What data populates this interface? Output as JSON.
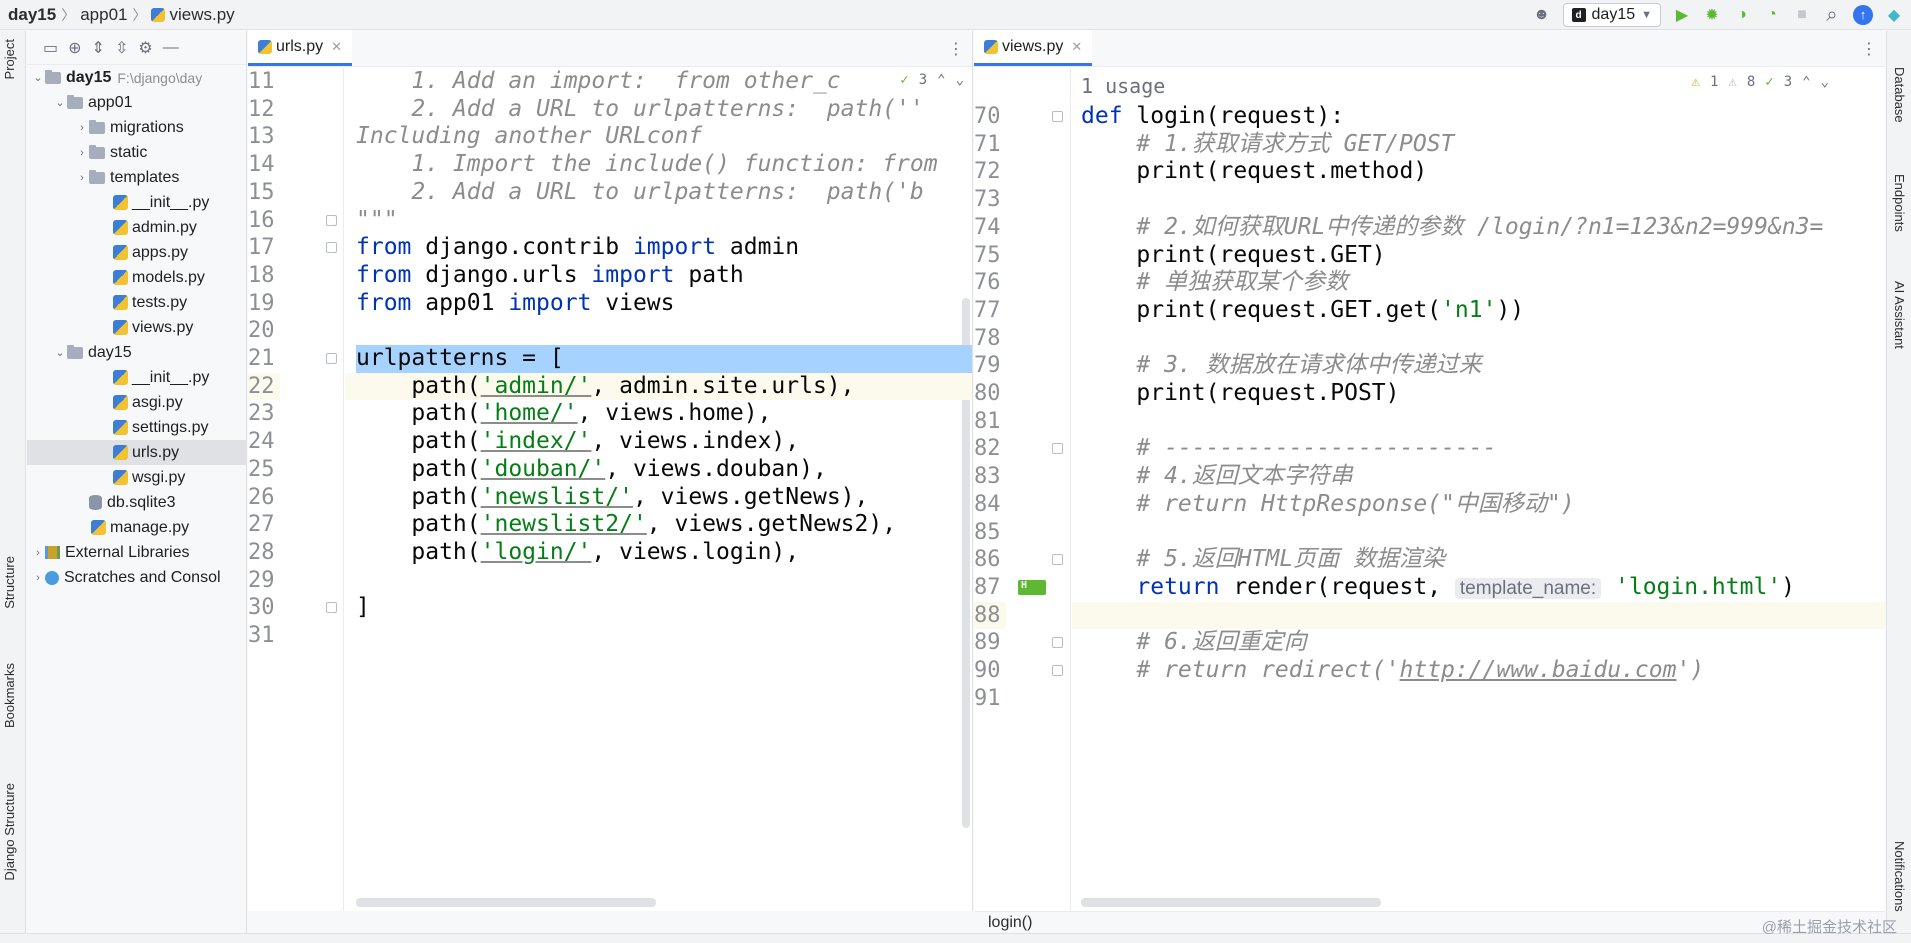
{
  "breadcrumb": {
    "project": "day15",
    "folder": "app01",
    "file": "views.py"
  },
  "run_config": {
    "label": "day15"
  },
  "project_panel": {
    "project_root_name": "day15",
    "project_root_path": "F:\\django\\day",
    "items": [
      {
        "label": "app01",
        "type": "folder",
        "depth": 1,
        "expanded": true
      },
      {
        "label": "migrations",
        "type": "folder",
        "depth": 2,
        "expanded": false
      },
      {
        "label": "static",
        "type": "folder",
        "depth": 2,
        "expanded": false
      },
      {
        "label": "templates",
        "type": "folder",
        "depth": 2,
        "expanded": false
      },
      {
        "label": "__init__.py",
        "type": "py",
        "depth": 3
      },
      {
        "label": "admin.py",
        "type": "py",
        "depth": 3
      },
      {
        "label": "apps.py",
        "type": "py",
        "depth": 3
      },
      {
        "label": "models.py",
        "type": "py",
        "depth": 3
      },
      {
        "label": "tests.py",
        "type": "py",
        "depth": 3
      },
      {
        "label": "views.py",
        "type": "py",
        "depth": 3
      },
      {
        "label": "day15",
        "type": "folder",
        "depth": 1,
        "expanded": true
      },
      {
        "label": "__init__.py",
        "type": "py",
        "depth": 3
      },
      {
        "label": "asgi.py",
        "type": "py",
        "depth": 3
      },
      {
        "label": "settings.py",
        "type": "py",
        "depth": 3
      },
      {
        "label": "urls.py",
        "type": "py",
        "depth": 3,
        "selected": true
      },
      {
        "label": "wsgi.py",
        "type": "py",
        "depth": 3
      },
      {
        "label": "db.sqlite3",
        "type": "db",
        "depth": 2
      },
      {
        "label": "manage.py",
        "type": "py",
        "depth": 2
      },
      {
        "label": "External Libraries",
        "type": "lib",
        "depth": 0,
        "expanded": false
      },
      {
        "label": "Scratches and Consol",
        "type": "scratch",
        "depth": 0,
        "expanded": false
      }
    ]
  },
  "left_tool_strip": {
    "project": "Project",
    "structure": "Structure",
    "bookmarks": "Bookmarks",
    "django_structure": "Django Structure"
  },
  "right_tool_strip": {
    "database": "Database",
    "endpoints": "Endpoints",
    "ai_assistant": "AI Assistant",
    "notifications": "Notifications"
  },
  "editor_left": {
    "tab": "urls.py",
    "inspection": {
      "weak_warnings": "3"
    },
    "lines": [
      {
        "n": "11",
        "tokens": [
          {
            "t": "    1. Add an import:  from other_c",
            "c": "cm"
          }
        ]
      },
      {
        "n": "12",
        "tokens": [
          {
            "t": "    2. Add a URL to urlpatterns:  path(''",
            "c": "cm"
          }
        ]
      },
      {
        "n": "13",
        "tokens": [
          {
            "t": "Including another URLconf",
            "c": "cm"
          }
        ]
      },
      {
        "n": "14",
        "tokens": [
          {
            "t": "    1. Import the include() function: from",
            "c": "cm"
          }
        ]
      },
      {
        "n": "15",
        "tokens": [
          {
            "t": "    2. Add a URL to urlpatterns:  path('b",
            "c": "cm"
          }
        ]
      },
      {
        "n": "16",
        "tokens": [
          {
            "t": "\"\"\"",
            "c": "cm"
          }
        ]
      },
      {
        "n": "17",
        "tokens": [
          {
            "t": "from",
            "c": "kw"
          },
          {
            "t": " django.contrib ",
            "c": ""
          },
          {
            "t": "import",
            "c": "kw"
          },
          {
            "t": " admin",
            "c": ""
          }
        ]
      },
      {
        "n": "18",
        "tokens": [
          {
            "t": "from",
            "c": "kw"
          },
          {
            "t": " django.urls ",
            "c": ""
          },
          {
            "t": "import",
            "c": "kw"
          },
          {
            "t": " path",
            "c": ""
          }
        ]
      },
      {
        "n": "19",
        "tokens": [
          {
            "t": "from",
            "c": "kw"
          },
          {
            "t": " app01 ",
            "c": ""
          },
          {
            "t": "import",
            "c": "kw"
          },
          {
            "t": " views",
            "c": ""
          }
        ]
      },
      {
        "n": "20",
        "tokens": []
      },
      {
        "n": "21",
        "tokens": [
          {
            "t": "urlpatterns = [",
            "c": ""
          }
        ],
        "sel": true
      },
      {
        "n": "22",
        "tokens": [
          {
            "t": "    path(",
            "c": ""
          },
          {
            "t": "'admin/'",
            "c": "st ul"
          },
          {
            "t": ", admin.site.urls),",
            "c": ""
          }
        ],
        "cur": true
      },
      {
        "n": "23",
        "tokens": [
          {
            "t": "    path(",
            "c": ""
          },
          {
            "t": "'home/'",
            "c": "st ul"
          },
          {
            "t": ", views.home),",
            "c": ""
          }
        ]
      },
      {
        "n": "24",
        "tokens": [
          {
            "t": "    path(",
            "c": ""
          },
          {
            "t": "'index/'",
            "c": "st ul"
          },
          {
            "t": ", views.index),",
            "c": ""
          }
        ]
      },
      {
        "n": "25",
        "tokens": [
          {
            "t": "    path(",
            "c": ""
          },
          {
            "t": "'douban/'",
            "c": "st ul"
          },
          {
            "t": ", views.douban),",
            "c": ""
          }
        ]
      },
      {
        "n": "26",
        "tokens": [
          {
            "t": "    path(",
            "c": ""
          },
          {
            "t": "'newslist/'",
            "c": "st ul"
          },
          {
            "t": ", views.getNews),",
            "c": ""
          }
        ]
      },
      {
        "n": "27",
        "tokens": [
          {
            "t": "    path(",
            "c": ""
          },
          {
            "t": "'newslist2/'",
            "c": "st ul"
          },
          {
            "t": ", views.getNews2),",
            "c": ""
          }
        ]
      },
      {
        "n": "28",
        "tokens": [
          {
            "t": "    path(",
            "c": ""
          },
          {
            "t": "'login/'",
            "c": "st ul"
          },
          {
            "t": ", views.login),",
            "c": ""
          }
        ]
      },
      {
        "n": "29",
        "tokens": []
      },
      {
        "n": "30",
        "tokens": [
          {
            "t": "]",
            "c": ""
          }
        ]
      },
      {
        "n": "31",
        "tokens": []
      }
    ]
  },
  "editor_right": {
    "tab": "views.py",
    "usage_hint": "1 usage",
    "inspection": {
      "warnings": "1",
      "weak_warnings": "8",
      "typos": "3"
    },
    "lines": [
      {
        "n": "70",
        "tokens": [
          {
            "t": "def",
            "c": "kw"
          },
          {
            "t": " login(request):",
            "c": ""
          }
        ]
      },
      {
        "n": "71",
        "tokens": [
          {
            "t": "    ",
            "c": ""
          },
          {
            "t": "# 1.获取请求方式 GET/POST",
            "c": "cm"
          }
        ]
      },
      {
        "n": "72",
        "tokens": [
          {
            "t": "    print(request.method)",
            "c": ""
          }
        ]
      },
      {
        "n": "73",
        "tokens": []
      },
      {
        "n": "74",
        "tokens": [
          {
            "t": "    ",
            "c": ""
          },
          {
            "t": "# 2.如何获取URL中传递的参数 /login/?n1=123&n2=999&n3=",
            "c": "cm"
          }
        ]
      },
      {
        "n": "75",
        "tokens": [
          {
            "t": "    print(request.GET)",
            "c": ""
          }
        ]
      },
      {
        "n": "76",
        "tokens": [
          {
            "t": "    ",
            "c": ""
          },
          {
            "t": "# 单独获取某个参数",
            "c": "cm"
          }
        ]
      },
      {
        "n": "77",
        "tokens": [
          {
            "t": "    print(request.GET.get(",
            "c": ""
          },
          {
            "t": "'n1'",
            "c": "st"
          },
          {
            "t": "))",
            "c": ""
          }
        ]
      },
      {
        "n": "78",
        "tokens": []
      },
      {
        "n": "79",
        "tokens": [
          {
            "t": "    ",
            "c": ""
          },
          {
            "t": "# 3. 数据放在请求体中传递过来",
            "c": "cm"
          }
        ]
      },
      {
        "n": "80",
        "tokens": [
          {
            "t": "    print(request.POST)",
            "c": ""
          }
        ]
      },
      {
        "n": "81",
        "tokens": []
      },
      {
        "n": "82",
        "tokens": [
          {
            "t": "    ",
            "c": ""
          },
          {
            "t": "# ------------------------",
            "c": "cm"
          }
        ]
      },
      {
        "n": "83",
        "tokens": [
          {
            "t": "    ",
            "c": ""
          },
          {
            "t": "# 4.返回文本字符串",
            "c": "cm"
          }
        ]
      },
      {
        "n": "84",
        "tokens": [
          {
            "t": "    ",
            "c": ""
          },
          {
            "t": "# return HttpResponse(\"中国移动\")",
            "c": "cm"
          }
        ]
      },
      {
        "n": "85",
        "tokens": []
      },
      {
        "n": "86",
        "tokens": [
          {
            "t": "    ",
            "c": ""
          },
          {
            "t": "# 5.返回HTML页面 数据渲染",
            "c": "cm"
          }
        ]
      },
      {
        "n": "87",
        "tokens": [
          {
            "t": "    ",
            "c": ""
          },
          {
            "t": "return",
            "c": "kw"
          },
          {
            "t": " render(request, ",
            "c": ""
          },
          {
            "t": "template_name:",
            "c": "hint"
          },
          {
            "t": " ",
            "c": ""
          },
          {
            "t": "'login.html'",
            "c": "st"
          },
          {
            "t": ")",
            "c": ""
          }
        ]
      },
      {
        "n": "88",
        "tokens": [],
        "cur": true
      },
      {
        "n": "89",
        "tokens": [
          {
            "t": "    ",
            "c": ""
          },
          {
            "t": "# 6.返回重定向",
            "c": "cm"
          }
        ]
      },
      {
        "n": "90",
        "tokens": [
          {
            "t": "    ",
            "c": ""
          },
          {
            "t": "# return redirect('",
            "c": "cm"
          },
          {
            "t": "http://www.baidu.com",
            "c": "cm ul"
          },
          {
            "t": "')",
            "c": "cm"
          }
        ]
      },
      {
        "n": "91",
        "tokens": []
      }
    ]
  },
  "status_bar": {
    "breadcrumb": "login()"
  },
  "watermark": "@稀土掘金技术社区",
  "icons": {
    "breadcrumb_separator": "〉",
    "close": "✕",
    "more": "⋮",
    "run": "▶",
    "search": "⌕",
    "expanded": "⌄",
    "collapsed": "›"
  },
  "colors": {
    "keyword": "#0033b3",
    "comment": "#8c8c8c",
    "string": "#067d17",
    "selection": "#a6d2ff",
    "accent": "#3574f0"
  }
}
